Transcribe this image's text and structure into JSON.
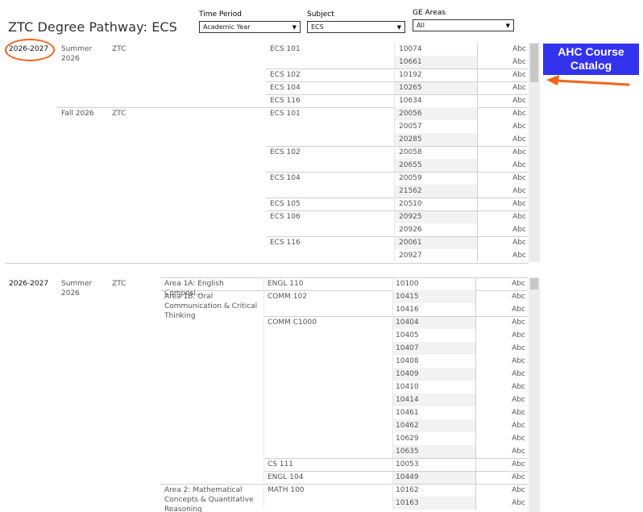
{
  "title": "ZTC Degree Pathway: ECS",
  "filters": {
    "time_period": {
      "label": "Time Period",
      "value": "Academic Year"
    },
    "subject": {
      "label": "Subject",
      "value": "ECS"
    },
    "ge_areas": {
      "label": "GE Areas",
      "value": "All"
    }
  },
  "catalog_button": {
    "label": "AHC Course Catalog"
  },
  "annotation_color": "#f26419",
  "button_color": "#3333ee",
  "table1": {
    "year": "2026-2027",
    "terms": [
      {
        "term": "Summer 2026",
        "type": "ZTC",
        "rows": [
          {
            "course": "ECS 101",
            "crn": "10074",
            "cell": "Abc"
          },
          {
            "course": "",
            "crn": "10661",
            "cell": "Abc"
          },
          {
            "course": "ECS 102",
            "crn": "10192",
            "cell": "Abc"
          },
          {
            "course": "ECS 104",
            "crn": "10265",
            "cell": "Abc"
          },
          {
            "course": "ECS 116",
            "crn": "10634",
            "cell": "Abc"
          }
        ]
      },
      {
        "term": "Fall 2026",
        "type": "ZTC",
        "rows": [
          {
            "course": "ECS 101",
            "crn": "20056",
            "cell": "Abc"
          },
          {
            "course": "",
            "crn": "20057",
            "cell": "Abc"
          },
          {
            "course": "",
            "crn": "20285",
            "cell": "Abc"
          },
          {
            "course": "ECS 102",
            "crn": "20058",
            "cell": "Abc"
          },
          {
            "course": "",
            "crn": "20655",
            "cell": "Abc"
          },
          {
            "course": "ECS 104",
            "crn": "20059",
            "cell": "Abc"
          },
          {
            "course": "",
            "crn": "21562",
            "cell": "Abc"
          },
          {
            "course": "ECS 105",
            "crn": "20510",
            "cell": "Abc"
          },
          {
            "course": "ECS 106",
            "crn": "20925",
            "cell": "Abc"
          },
          {
            "course": "",
            "crn": "20926",
            "cell": "Abc"
          },
          {
            "course": "ECS 116",
            "crn": "20061",
            "cell": "Abc"
          },
          {
            "course": "",
            "crn": "20927",
            "cell": "Abc"
          }
        ]
      }
    ]
  },
  "table2": {
    "year": "2026-2027",
    "term": "Summer 2026",
    "type": "ZTC",
    "areas": [
      {
        "area": "Area 1A: English Composi...",
        "rows": [
          {
            "course": "ENGL 110",
            "crn": "10100",
            "cell": "Abc"
          }
        ]
      },
      {
        "area": "Area 1B: Oral Communication & Critical Thinking",
        "rows": [
          {
            "course": "COMM 102",
            "crn": "10415",
            "cell": "Abc"
          },
          {
            "course": "",
            "crn": "10416",
            "cell": "Abc"
          },
          {
            "course": "COMM C1000",
            "crn": "10404",
            "cell": "Abc"
          },
          {
            "course": "",
            "crn": "10405",
            "cell": "Abc"
          },
          {
            "course": "",
            "crn": "10407",
            "cell": "Abc"
          },
          {
            "course": "",
            "crn": "10408",
            "cell": "Abc"
          },
          {
            "course": "",
            "crn": "10409",
            "cell": "Abc"
          },
          {
            "course": "",
            "crn": "10410",
            "cell": "Abc"
          },
          {
            "course": "",
            "crn": "10414",
            "cell": "Abc"
          },
          {
            "course": "",
            "crn": "10461",
            "cell": "Abc"
          },
          {
            "course": "",
            "crn": "10462",
            "cell": "Abc"
          },
          {
            "course": "",
            "crn": "10629",
            "cell": "Abc"
          },
          {
            "course": "",
            "crn": "10635",
            "cell": "Abc"
          },
          {
            "course": "CS 111",
            "crn": "10053",
            "cell": "Abc"
          },
          {
            "course": "ENGL 104",
            "crn": "10449",
            "cell": "Abc"
          }
        ]
      },
      {
        "area": "Area 2: Mathematical Concepts & Quantitative Reasoning",
        "rows": [
          {
            "course": "MATH 100",
            "crn": "10162",
            "cell": "Abc"
          },
          {
            "course": "",
            "crn": "10163",
            "cell": "Abc"
          }
        ]
      }
    ]
  }
}
